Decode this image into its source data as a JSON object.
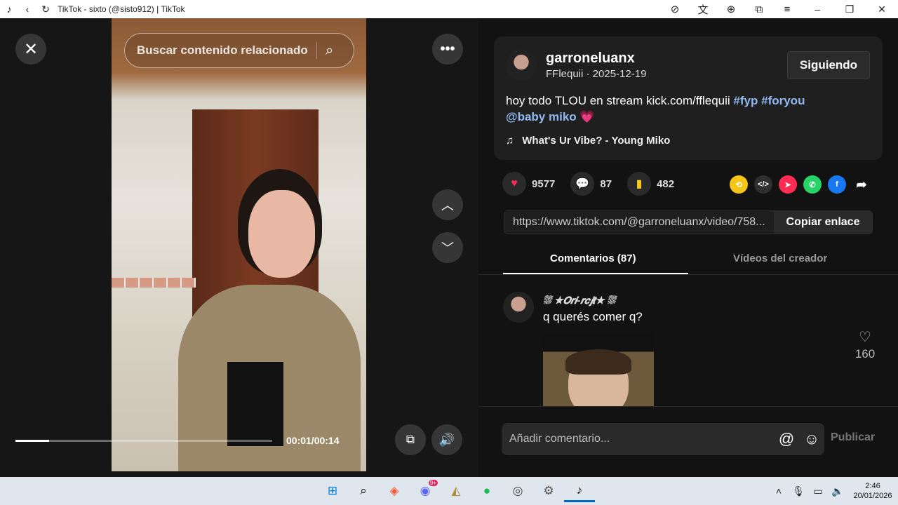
{
  "titlebar": {
    "title": "TikTok - sixto (@sisto912) | TikTok"
  },
  "player": {
    "search_placeholder": "Buscar contenido relacionado",
    "time": "00:01/00:14",
    "progress": 0.13
  },
  "post": {
    "username": "garroneluanx",
    "subline": "FFlequii · 2025-12-19",
    "follow_label": "Siguiendo",
    "caption_text": "hoy todo TLOU en stream kick.com/fflequii ",
    "tag1": "#fyp",
    "tag2": "#foryou",
    "mention": "@baby miko",
    "emoji": "💗",
    "music": "What's Ur Vibe? - Young Miko"
  },
  "actions": {
    "likes": "9577",
    "comments": "87",
    "saves": "482"
  },
  "link": {
    "url": "https://www.tiktok.com/@garroneluanx/video/758...",
    "copy_label": "Copiar enlace"
  },
  "tabs": {
    "comments": "Comentarios (87)",
    "creator_videos": "Vídeos del creador"
  },
  "comment": {
    "name": "⛆ ★𝙊𝙧𝙞-𝙧𝙘𝙟𝙩★ ⛆",
    "text": "q querés comer q?",
    "likes": "160"
  },
  "composer": {
    "placeholder": "Añadir comentario...",
    "publish_label": "Publicar"
  },
  "taskbar": {
    "time": "2:46",
    "date": "20/01/2026",
    "discord_badge": "9+"
  },
  "colors": {
    "like": "#fe2c55",
    "save": "#facc15",
    "tag": "#8fb9f2"
  }
}
